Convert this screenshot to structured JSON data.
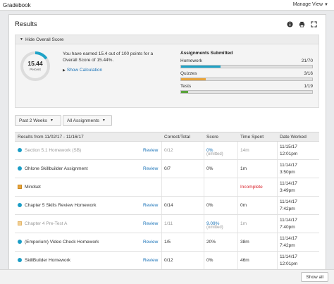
{
  "app": {
    "title": "Gradebook",
    "manage_view": "Manage View"
  },
  "results": {
    "title": "Results",
    "hide_overall_label": "Hide Overall Score",
    "score_value": "15.44",
    "score_caption": "Percent",
    "score_fraction": 0.1544,
    "earned_text": "You have earned 15.4 out of 100 points for a Overall Score of 15.44%.",
    "show_calc": "Show Calculation",
    "accent_color": "#1fa3c7"
  },
  "assignments_submitted": {
    "title": "Assignments Submitted",
    "rows": [
      {
        "label": "Homework",
        "count": "21/70",
        "fraction": 0.3,
        "color": "#1fa3c7"
      },
      {
        "label": "Quizzes",
        "count": "3/16",
        "fraction": 0.1875,
        "color": "#e8a43a"
      },
      {
        "label": "Tests",
        "count": "1/19",
        "fraction": 0.0526,
        "color": "#5aa33c"
      }
    ]
  },
  "filters": {
    "period": "Past 2 Weeks",
    "type": "All Assignments"
  },
  "table": {
    "headers": {
      "results": "Results from 11/02/17 - 11/16/17",
      "correct": "Correct/Total",
      "score": "Score",
      "time": "Time Spent",
      "date": "Date Worked"
    },
    "rows": [
      {
        "icon": "dot",
        "name": "Section 5.1 Homework (SB)",
        "muted": true,
        "review": "Review",
        "correct": "0/12",
        "score": "0%",
        "score_note": "(omitted)",
        "time": "14m",
        "date": "11/15/17",
        "time_of_day": "12:01pm"
      },
      {
        "icon": "dot",
        "name": "Ohlone Skillbuilder Assignment",
        "muted": false,
        "review": "Review",
        "correct": "0/7",
        "score": "0%",
        "score_note": "",
        "time": "1m",
        "date": "11/14/17",
        "time_of_day": "3:50pm"
      },
      {
        "icon": "sq",
        "name": "Mindset",
        "muted": false,
        "review": "",
        "correct": "",
        "score": "",
        "score_note": "",
        "time": "Incomplete",
        "date": "11/14/17",
        "time_of_day": "3:49pm"
      },
      {
        "icon": "dot",
        "name": "Chapter 5 Skills Review Homework",
        "muted": false,
        "review": "Review",
        "correct": "0/14",
        "score": "0%",
        "score_note": "",
        "time": "0m",
        "date": "11/14/17",
        "time_of_day": "7:42pm"
      },
      {
        "icon": "sq",
        "name": "Chapter 4 Pre-Test A",
        "muted": true,
        "review": "Review",
        "correct": "1/11",
        "score": "9.09%",
        "score_note": "(omitted)",
        "time": "1m",
        "date": "11/14/17",
        "time_of_day": "7:40pm"
      },
      {
        "icon": "dot",
        "name": "(Emporium) Video Check Homework",
        "muted": false,
        "review": "Review",
        "correct": "1/5",
        "score": "20%",
        "score_note": "",
        "time": "38m",
        "date": "11/14/17",
        "time_of_day": "7:42pm"
      },
      {
        "icon": "dot",
        "name": "SkillBuilder Homework",
        "muted": false,
        "review": "Review",
        "correct": "0/12",
        "score": "0%",
        "score_note": "",
        "time": "46m",
        "date": "11/14/17",
        "time_of_day": "12:01pm"
      }
    ]
  },
  "footer": {
    "show_all": "Show all"
  }
}
